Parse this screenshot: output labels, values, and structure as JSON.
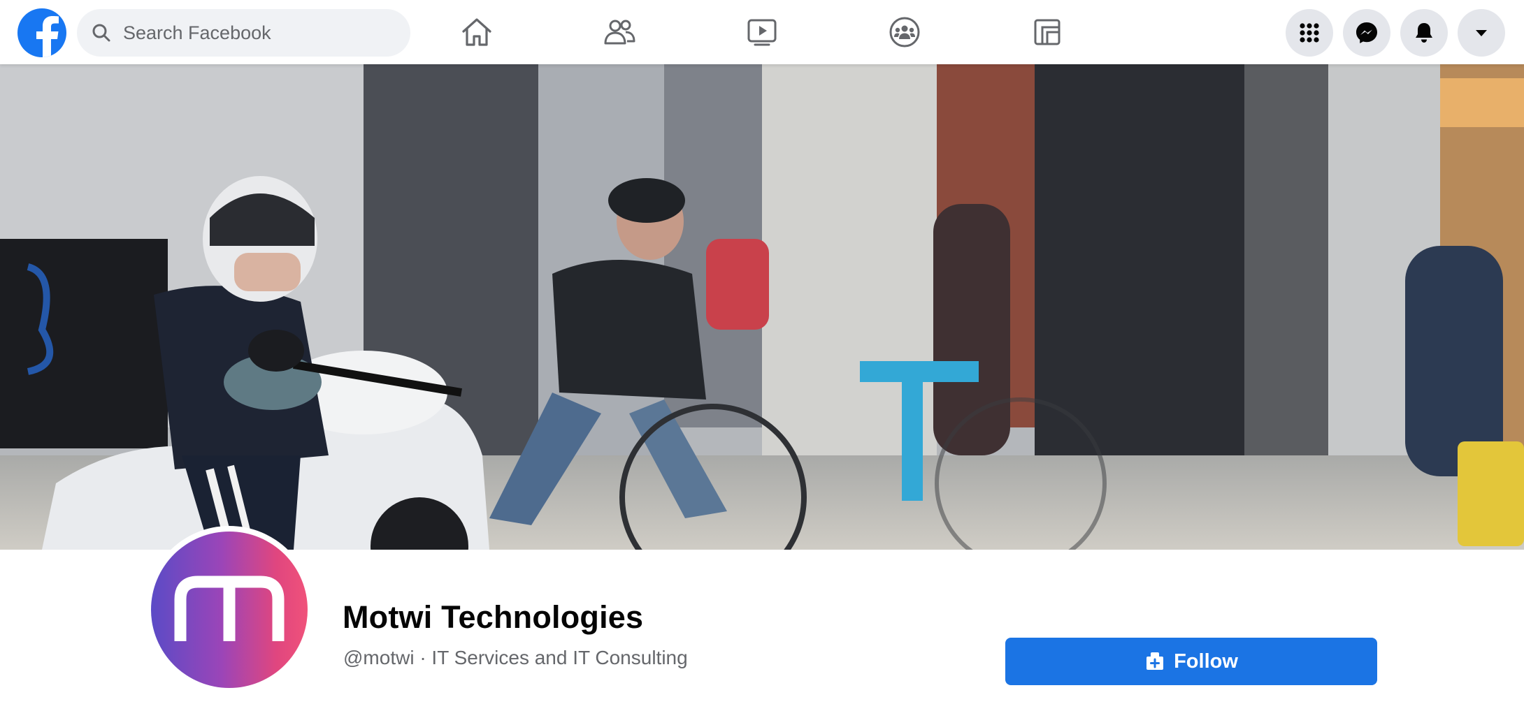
{
  "app": {
    "name": "Facebook"
  },
  "header": {
    "search": {
      "placeholder": "Search Facebook",
      "value": ""
    },
    "nav_icons": [
      "home-icon",
      "friends-icon",
      "watch-icon",
      "groups-icon",
      "gaming-icon"
    ],
    "action_icons": [
      "menu-grid-icon",
      "messenger-icon",
      "notifications-bell-icon",
      "account-caret-icon"
    ]
  },
  "profile": {
    "name": "Motwi Technologies",
    "subtitle": "@motwi · IT Services and IT Consulting",
    "avatar_letter": "m",
    "follow_label": "Follow"
  },
  "colors": {
    "brand": "#1877f2",
    "follow_button": "#1b74e4",
    "avatar_gradient": [
      "#5b4bc6",
      "#f0527a"
    ],
    "secondary_text": "#65676b"
  }
}
